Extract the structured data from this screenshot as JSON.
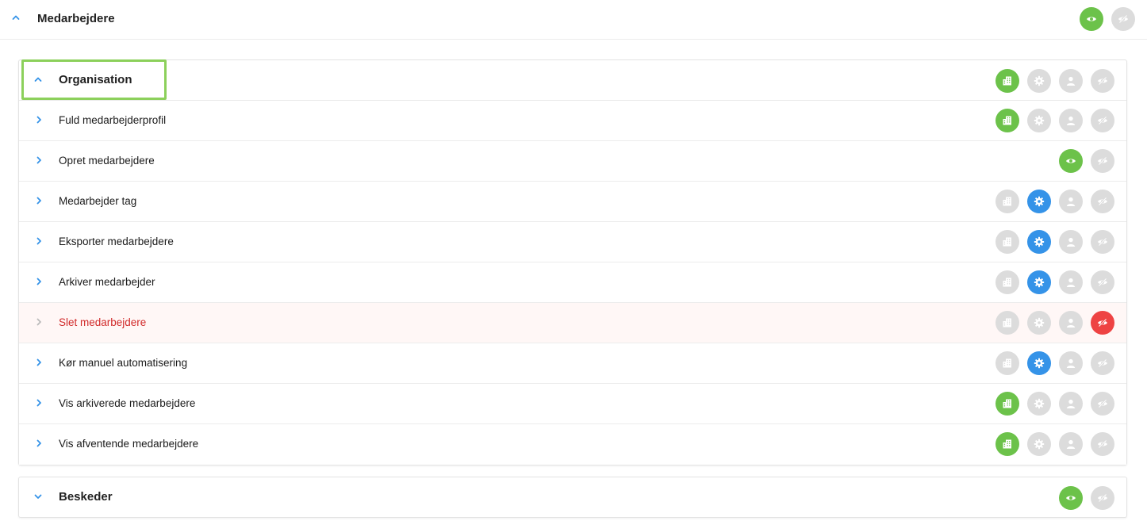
{
  "header": {
    "title": "Medarbejdere",
    "icons": [
      {
        "name": "eye-icon",
        "state": "green"
      },
      {
        "name": "eye-off-icon",
        "state": "grey"
      }
    ]
  },
  "organisation": {
    "title": "Organisation",
    "icons": [
      {
        "name": "building-icon",
        "state": "green"
      },
      {
        "name": "gear-icon",
        "state": "grey"
      },
      {
        "name": "user-icon",
        "state": "grey"
      },
      {
        "name": "eye-off-icon",
        "state": "grey"
      }
    ],
    "rows": [
      {
        "label": "Fuld medarbejderprofil",
        "danger": false,
        "icons": [
          {
            "name": "building-icon",
            "state": "green"
          },
          {
            "name": "gear-icon",
            "state": "grey"
          },
          {
            "name": "user-icon",
            "state": "grey"
          },
          {
            "name": "eye-off-icon",
            "state": "grey"
          }
        ]
      },
      {
        "label": "Opret medarbejdere",
        "danger": false,
        "icons": [
          {
            "name": "eye-icon",
            "state": "green"
          },
          {
            "name": "eye-off-icon",
            "state": "grey"
          }
        ]
      },
      {
        "label": "Medarbejder tag",
        "danger": false,
        "icons": [
          {
            "name": "building-icon",
            "state": "grey"
          },
          {
            "name": "gear-icon",
            "state": "blue"
          },
          {
            "name": "user-icon",
            "state": "grey"
          },
          {
            "name": "eye-off-icon",
            "state": "grey"
          }
        ]
      },
      {
        "label": "Eksporter medarbejdere",
        "danger": false,
        "icons": [
          {
            "name": "building-icon",
            "state": "grey"
          },
          {
            "name": "gear-icon",
            "state": "blue"
          },
          {
            "name": "user-icon",
            "state": "grey"
          },
          {
            "name": "eye-off-icon",
            "state": "grey"
          }
        ]
      },
      {
        "label": "Arkiver medarbejder",
        "danger": false,
        "icons": [
          {
            "name": "building-icon",
            "state": "grey"
          },
          {
            "name": "gear-icon",
            "state": "blue"
          },
          {
            "name": "user-icon",
            "state": "grey"
          },
          {
            "name": "eye-off-icon",
            "state": "grey"
          }
        ]
      },
      {
        "label": "Slet medarbejdere",
        "danger": true,
        "icons": [
          {
            "name": "building-icon",
            "state": "grey"
          },
          {
            "name": "gear-icon",
            "state": "grey"
          },
          {
            "name": "user-icon",
            "state": "grey"
          },
          {
            "name": "eye-off-icon",
            "state": "red"
          }
        ]
      },
      {
        "label": "Kør manuel automatisering",
        "danger": false,
        "icons": [
          {
            "name": "building-icon",
            "state": "grey"
          },
          {
            "name": "gear-icon",
            "state": "blue"
          },
          {
            "name": "user-icon",
            "state": "grey"
          },
          {
            "name": "eye-off-icon",
            "state": "grey"
          }
        ]
      },
      {
        "label": "Vis arkiverede medarbejdere",
        "danger": false,
        "icons": [
          {
            "name": "building-icon",
            "state": "green"
          },
          {
            "name": "gear-icon",
            "state": "grey"
          },
          {
            "name": "user-icon",
            "state": "grey"
          },
          {
            "name": "eye-off-icon",
            "state": "grey"
          }
        ]
      },
      {
        "label": "Vis afventende medarbejdere",
        "danger": false,
        "icons": [
          {
            "name": "building-icon",
            "state": "green"
          },
          {
            "name": "gear-icon",
            "state": "grey"
          },
          {
            "name": "user-icon",
            "state": "grey"
          },
          {
            "name": "eye-off-icon",
            "state": "grey"
          }
        ]
      }
    ]
  },
  "beskeder": {
    "title": "Beskeder",
    "icons": [
      {
        "name": "eye-icon",
        "state": "green"
      },
      {
        "name": "eye-off-icon",
        "state": "grey"
      }
    ]
  },
  "colors": {
    "green": "#6cc24a",
    "blue": "#3593e8",
    "red": "#ee4343",
    "grey": "#dcdcdc",
    "accent": "#3593e8",
    "danger_text": "#d12a2a",
    "focus_outline": "#8cd05b"
  }
}
